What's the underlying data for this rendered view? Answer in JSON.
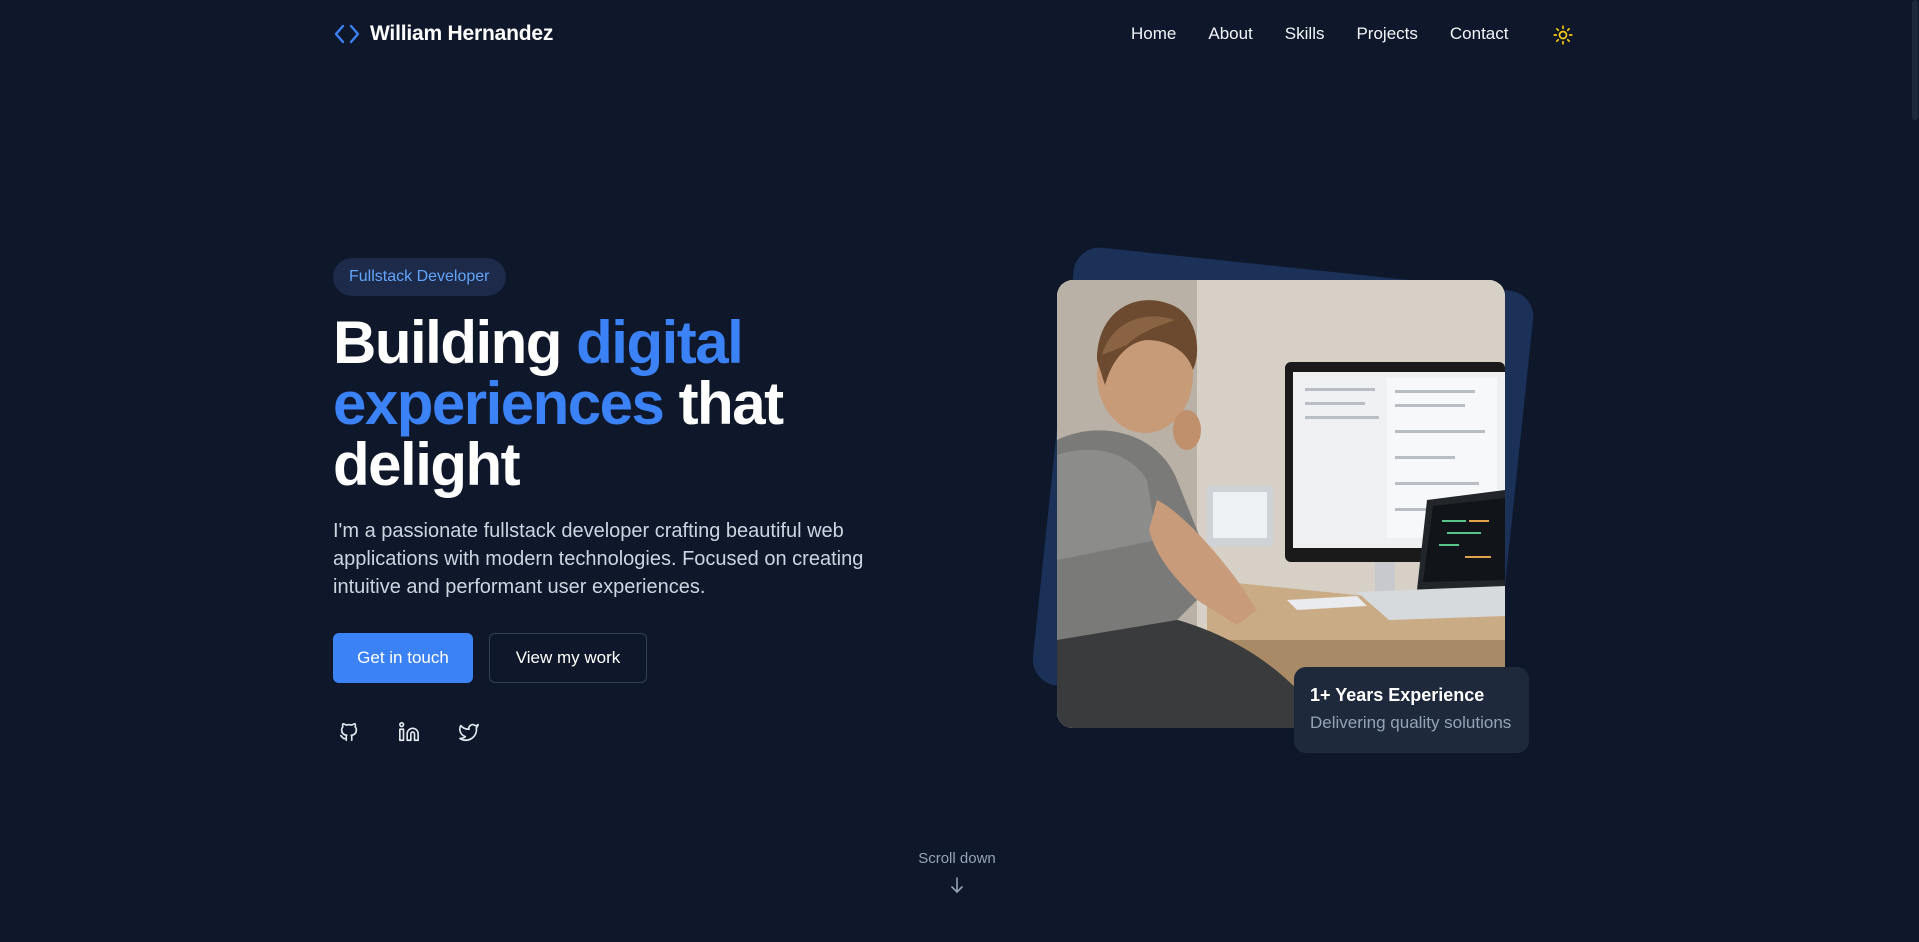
{
  "header": {
    "brand_name": "William Hernandez",
    "nav": [
      "Home",
      "About",
      "Skills",
      "Projects",
      "Contact"
    ]
  },
  "hero": {
    "badge": "Fullstack Developer",
    "headline": {
      "part1": "Building ",
      "accent1": "digital",
      "accent2": "experiences",
      "part2": " that",
      "part3": "delight"
    },
    "intro": "I'm a passionate fullstack developer crafting beautiful web applications with modern technologies. Focused on creating intuitive and performant user experiences.",
    "primary_cta": "Get in touch",
    "secondary_cta": "View my work",
    "socials": [
      "github-icon",
      "linkedin-icon",
      "twitter-icon"
    ]
  },
  "experience_card": {
    "title": "1+ Years Experience",
    "subtitle": "Delivering quality solutions"
  },
  "scroll": {
    "label": "Scroll down"
  },
  "colors": {
    "background": "#0f172a",
    "accent": "#3b82f6",
    "badge_text": "#60a5fa",
    "muted": "#94a3b8",
    "sun": "#facc15"
  }
}
